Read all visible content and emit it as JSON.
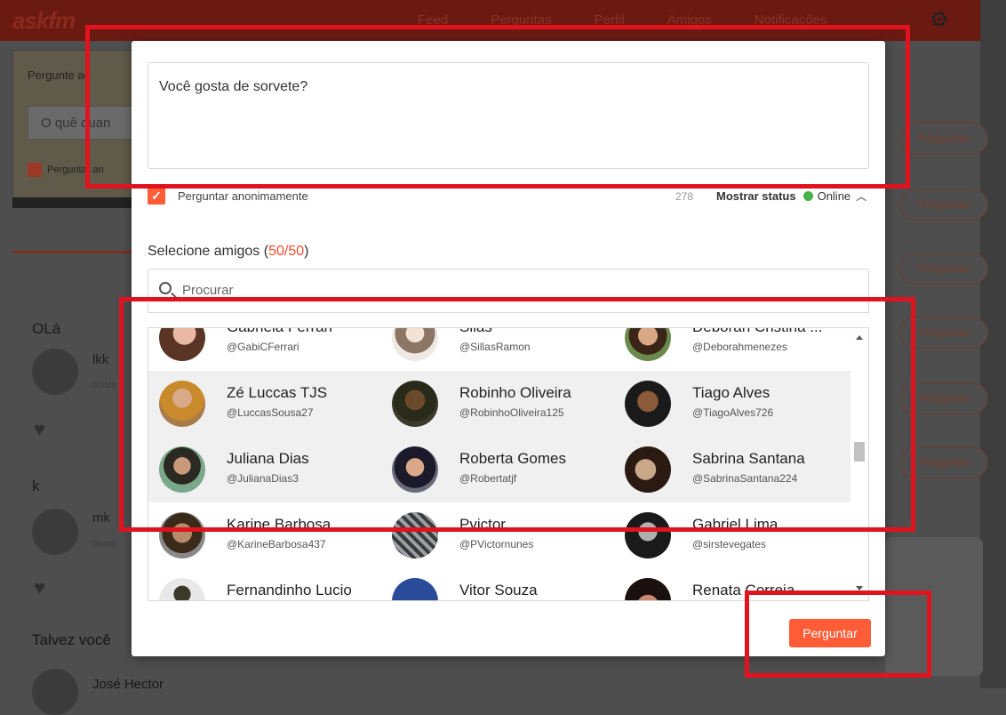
{
  "background": {
    "logo": "askfm",
    "nav": [
      "Feed",
      "Perguntas",
      "Perfil",
      "Amigos",
      "Notificações"
    ],
    "left_panel": {
      "ask_label": "Pergunte ao",
      "input_placeholder": "O quê quan",
      "anon_label": "Perguntar an"
    },
    "feed": [
      {
        "title": "OLá",
        "name": "lkk",
        "sub": "Gusta"
      },
      {
        "title": "k",
        "name": "mk",
        "sub": "Gusta"
      }
    ],
    "maybe_label": "Talvez você",
    "suggested_name": "José Hector",
    "right_buttons": [
      "Perguntar",
      "Perguntar",
      "Perguntar",
      "Perguntar",
      "Perguntar",
      "Perguntar"
    ]
  },
  "modal": {
    "question_text": "Você gosta de sorvete?",
    "anon_label": "Perguntar anonimamente",
    "char_count": "278",
    "status_label": "Mostrar status",
    "status_value": "Online",
    "select_label": "Selecione amigos (",
    "select_count": "50/50",
    "select_close": ")",
    "search_placeholder": "Procurar",
    "submit_label": "Perguntar",
    "friends": [
      [
        {
          "name": "Gabriela Ferrari",
          "user": "@GabiCFerrari"
        },
        {
          "name": "Silas",
          "user": "@SillasRamon"
        },
        {
          "name": "Deborah Cristina ...",
          "user": "@Deborahmenezes"
        }
      ],
      [
        {
          "name": "Zé Luccas TJS",
          "user": "@LuccasSousa27"
        },
        {
          "name": "Robinho Oliveira",
          "user": "@RobinhoOliveira125"
        },
        {
          "name": "Tiago Alves",
          "user": "@TiagoAlves726"
        }
      ],
      [
        {
          "name": "Juliana Dias",
          "user": "@JulianaDias3"
        },
        {
          "name": "Roberta Gomes",
          "user": "@Robertatjf"
        },
        {
          "name": "Sabrina Santana",
          "user": "@SabrinaSantana224"
        }
      ],
      [
        {
          "name": "Karine Barbosa",
          "user": "@KarineBarbosa437"
        },
        {
          "name": "Pvictor",
          "user": "@PVictornunes"
        },
        {
          "name": "Gabriel Lima",
          "user": "@sirstevegates"
        }
      ],
      [
        {
          "name": "Fernandinho Lucio",
          "user": ""
        },
        {
          "name": "Vitor Souza",
          "user": ""
        },
        {
          "name": "Renata Correia",
          "user": ""
        }
      ]
    ]
  },
  "colors": {
    "accent": "#ff5c37",
    "count_red": "#ff4b2b",
    "online_green": "#43b244",
    "highlight": "#e0131f"
  }
}
